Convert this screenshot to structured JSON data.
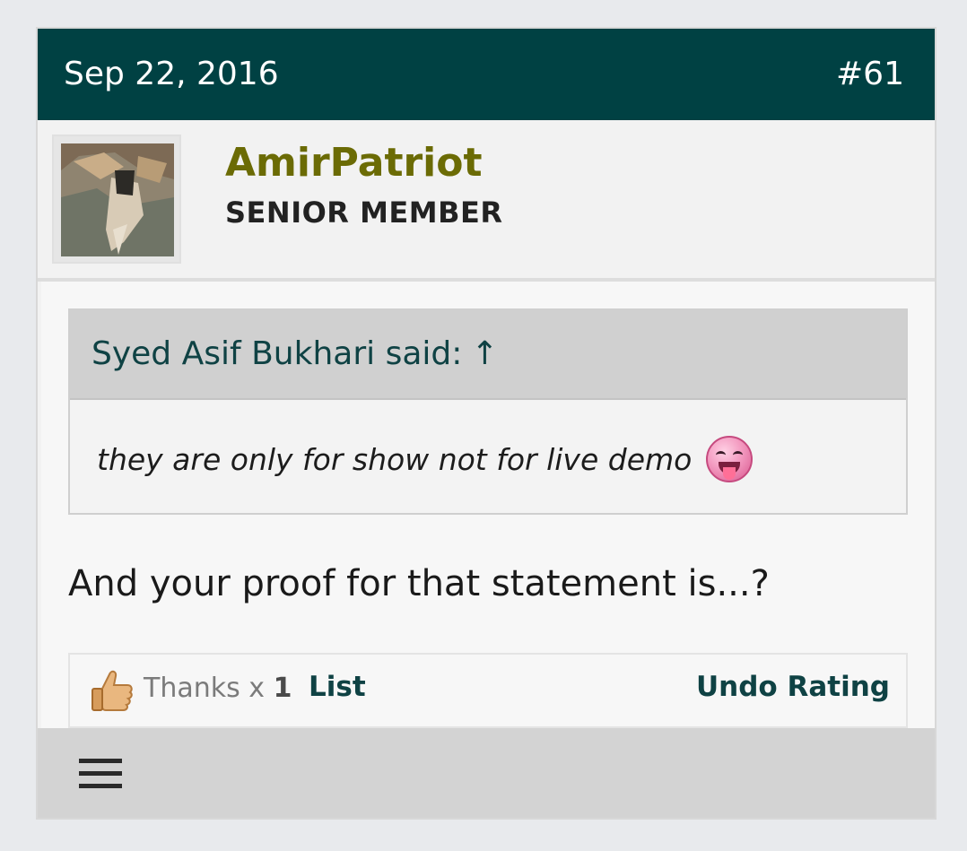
{
  "post": {
    "date": "Sep 22, 2016",
    "number": "#61"
  },
  "user": {
    "name": "AmirPatriot",
    "title": "SENIOR MEMBER"
  },
  "quote": {
    "author": "Syed Asif Bukhari said:",
    "arrow": "↑",
    "text": "they are only for show not for live demo",
    "emoji": "tongue-out-smiley-icon"
  },
  "message": {
    "text": "And your proof for that statement is...?"
  },
  "likes": {
    "label": "Thanks x",
    "count": "1",
    "list_label": "List",
    "undo_label": "Undo Rating"
  },
  "footer": {
    "menu_icon": "hamburger-menu-icon"
  },
  "colors": {
    "header_bg": "#004143",
    "username": "#6b6b05",
    "link": "#0f4244"
  }
}
